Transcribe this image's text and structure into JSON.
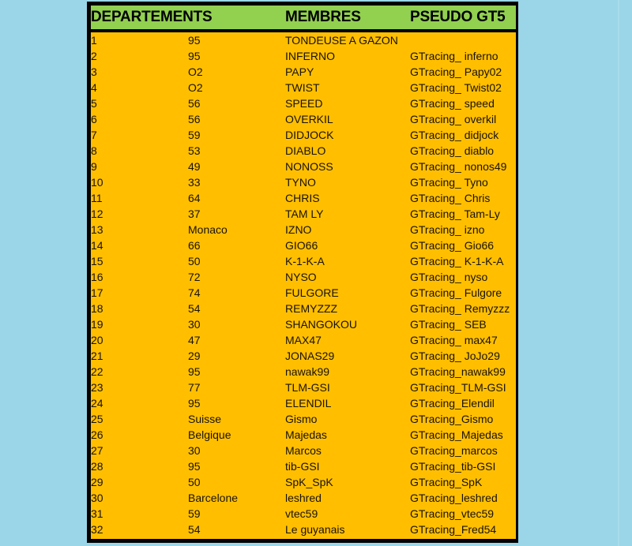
{
  "page": {
    "background_color": "#9bd6e8",
    "table_border_color": "#000000",
    "header_background_color": "#92d050",
    "body_background_color": "#ffbf00",
    "text_color": "#1a1208"
  },
  "table": {
    "headers": {
      "departements": "DEPARTEMENTS",
      "membres": "MEMBRES",
      "pseudo": "PSEUDO GT5"
    },
    "rows": [
      {
        "index": "1",
        "departement": "95",
        "membre": "TONDEUSE A GAZON",
        "pseudo": ""
      },
      {
        "index": "2",
        "departement": "95",
        "membre": "INFERNO",
        "pseudo": "GTracing_ inferno"
      },
      {
        "index": "3",
        "departement": "O2",
        "membre": "PAPY",
        "pseudo": "GTracing_ Papy02"
      },
      {
        "index": "4",
        "departement": "O2",
        "membre": "TWIST",
        "pseudo": "GTracing_ Twist02"
      },
      {
        "index": "5",
        "departement": "56",
        "membre": "SPEED",
        "pseudo": "GTracing_ speed"
      },
      {
        "index": "6",
        "departement": "56",
        "membre": "OVERKIL",
        "pseudo": "GTracing_ overkil"
      },
      {
        "index": "7",
        "departement": "59",
        "membre": "DIDJOCK",
        "pseudo": "GTracing_ didjock"
      },
      {
        "index": "8",
        "departement": "53",
        "membre": "DIABLO",
        "pseudo": "GTracing_ diablo"
      },
      {
        "index": "9",
        "departement": "49",
        "membre": "NONOSS",
        "pseudo": "GTracing_ nonos49"
      },
      {
        "index": "10",
        "departement": "33",
        "membre": "TYNO",
        "pseudo": "GTracing_ Tyno"
      },
      {
        "index": "11",
        "departement": "64",
        "membre": "CHRIS",
        "pseudo": "GTracing_ Chris"
      },
      {
        "index": "12",
        "departement": "37",
        "membre": "TAM LY",
        "pseudo": "GTracing_ Tam-Ly"
      },
      {
        "index": "13",
        "departement": "Monaco",
        "membre": "IZNO",
        "pseudo": "GTracing_ izno"
      },
      {
        "index": "14",
        "departement": "66",
        "membre": "GIO66",
        "pseudo": "GTracing_ Gio66"
      },
      {
        "index": "15",
        "departement": "50",
        "membre": "K-1-K-A",
        "pseudo": "GTracing_ K-1-K-A"
      },
      {
        "index": "16",
        "departement": "72",
        "membre": "NYSO",
        "pseudo": "GTracing_ nyso"
      },
      {
        "index": "17",
        "departement": "74",
        "membre": "FULGORE",
        "pseudo": "GTracing_ Fulgore"
      },
      {
        "index": "18",
        "departement": "54",
        "membre": "REMYZZZ",
        "pseudo": "GTracing_ Remyzzz"
      },
      {
        "index": "19",
        "departement": "30",
        "membre": "SHANGOKOU",
        "pseudo": "GTracing_ SEB"
      },
      {
        "index": "20",
        "departement": "47",
        "membre": "MAX47",
        "pseudo": "GTracing_ max47"
      },
      {
        "index": "21",
        "departement": "29",
        "membre": "JONAS29",
        "pseudo": "GTracing_ JoJo29"
      },
      {
        "index": "22",
        "departement": "95",
        "membre": "nawak99",
        "pseudo": "GTracing_nawak99"
      },
      {
        "index": "23",
        "departement": "77",
        "membre": "TLM-GSI",
        "pseudo": "GTracing_TLM-GSI"
      },
      {
        "index": "24",
        "departement": "95",
        "membre": "ELENDIL",
        "pseudo": "GTracing_Elendil"
      },
      {
        "index": "25",
        "departement": "Suisse",
        "membre": "Gismo",
        "pseudo": "GTracing_Gismo"
      },
      {
        "index": "26",
        "departement": "Belgique",
        "membre": "Majedas",
        "pseudo": "GTracing_Majedas"
      },
      {
        "index": "27",
        "departement": "30",
        "membre": "Marcos",
        "pseudo": "GTracing_marcos"
      },
      {
        "index": "28",
        "departement": "95",
        "membre": "tib-GSI",
        "pseudo": "GTracing_tib-GSI"
      },
      {
        "index": "29",
        "departement": "50",
        "membre": "SpK_SpK",
        "pseudo": "GTracing_SpK"
      },
      {
        "index": "30",
        "departement": "Barcelone",
        "membre": "leshred",
        "pseudo": "GTracing_leshred"
      },
      {
        "index": "31",
        "departement": "59",
        "membre": "vtec59",
        "pseudo": "GTracing_vtec59"
      },
      {
        "index": "32",
        "departement": "54",
        "membre": "Le guyanais",
        "pseudo": "GTracing_Fred54"
      }
    ]
  }
}
